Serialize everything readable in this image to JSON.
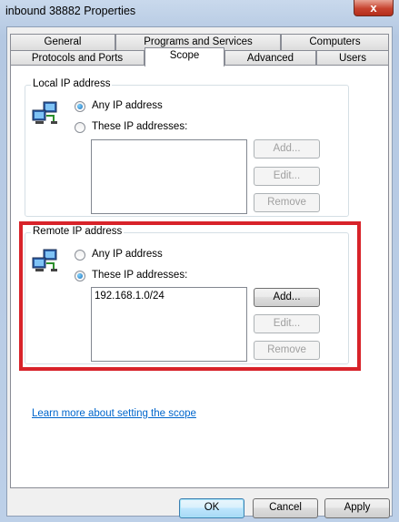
{
  "window": {
    "title": "inbound 38882 Properties",
    "close_label": "x"
  },
  "tabs": {
    "row1": [
      {
        "label": "General"
      },
      {
        "label": "Programs and Services"
      },
      {
        "label": "Computers"
      }
    ],
    "row2": [
      {
        "label": "Protocols and Ports"
      },
      {
        "label": "Scope"
      },
      {
        "label": "Advanced"
      },
      {
        "label": "Users"
      }
    ],
    "active": "Scope"
  },
  "local": {
    "title": "Local IP address",
    "any_label": "Any IP address",
    "these_label": "These IP addresses:",
    "selected": "any",
    "addresses": [],
    "add_label": "Add...",
    "edit_label": "Edit...",
    "remove_label": "Remove"
  },
  "remote": {
    "title": "Remote IP address",
    "any_label": "Any IP address",
    "these_label": "These IP addresses:",
    "selected": "these",
    "addresses": [
      "192.168.1.0/24"
    ],
    "add_label": "Add...",
    "edit_label": "Edit...",
    "remove_label": "Remove"
  },
  "learn_more": "Learn more about setting the scope",
  "footer": {
    "ok_label": "OK",
    "cancel_label": "Cancel",
    "apply_label": "Apply"
  },
  "colors": {
    "highlight": "#d8232a",
    "link": "#0066cc"
  }
}
